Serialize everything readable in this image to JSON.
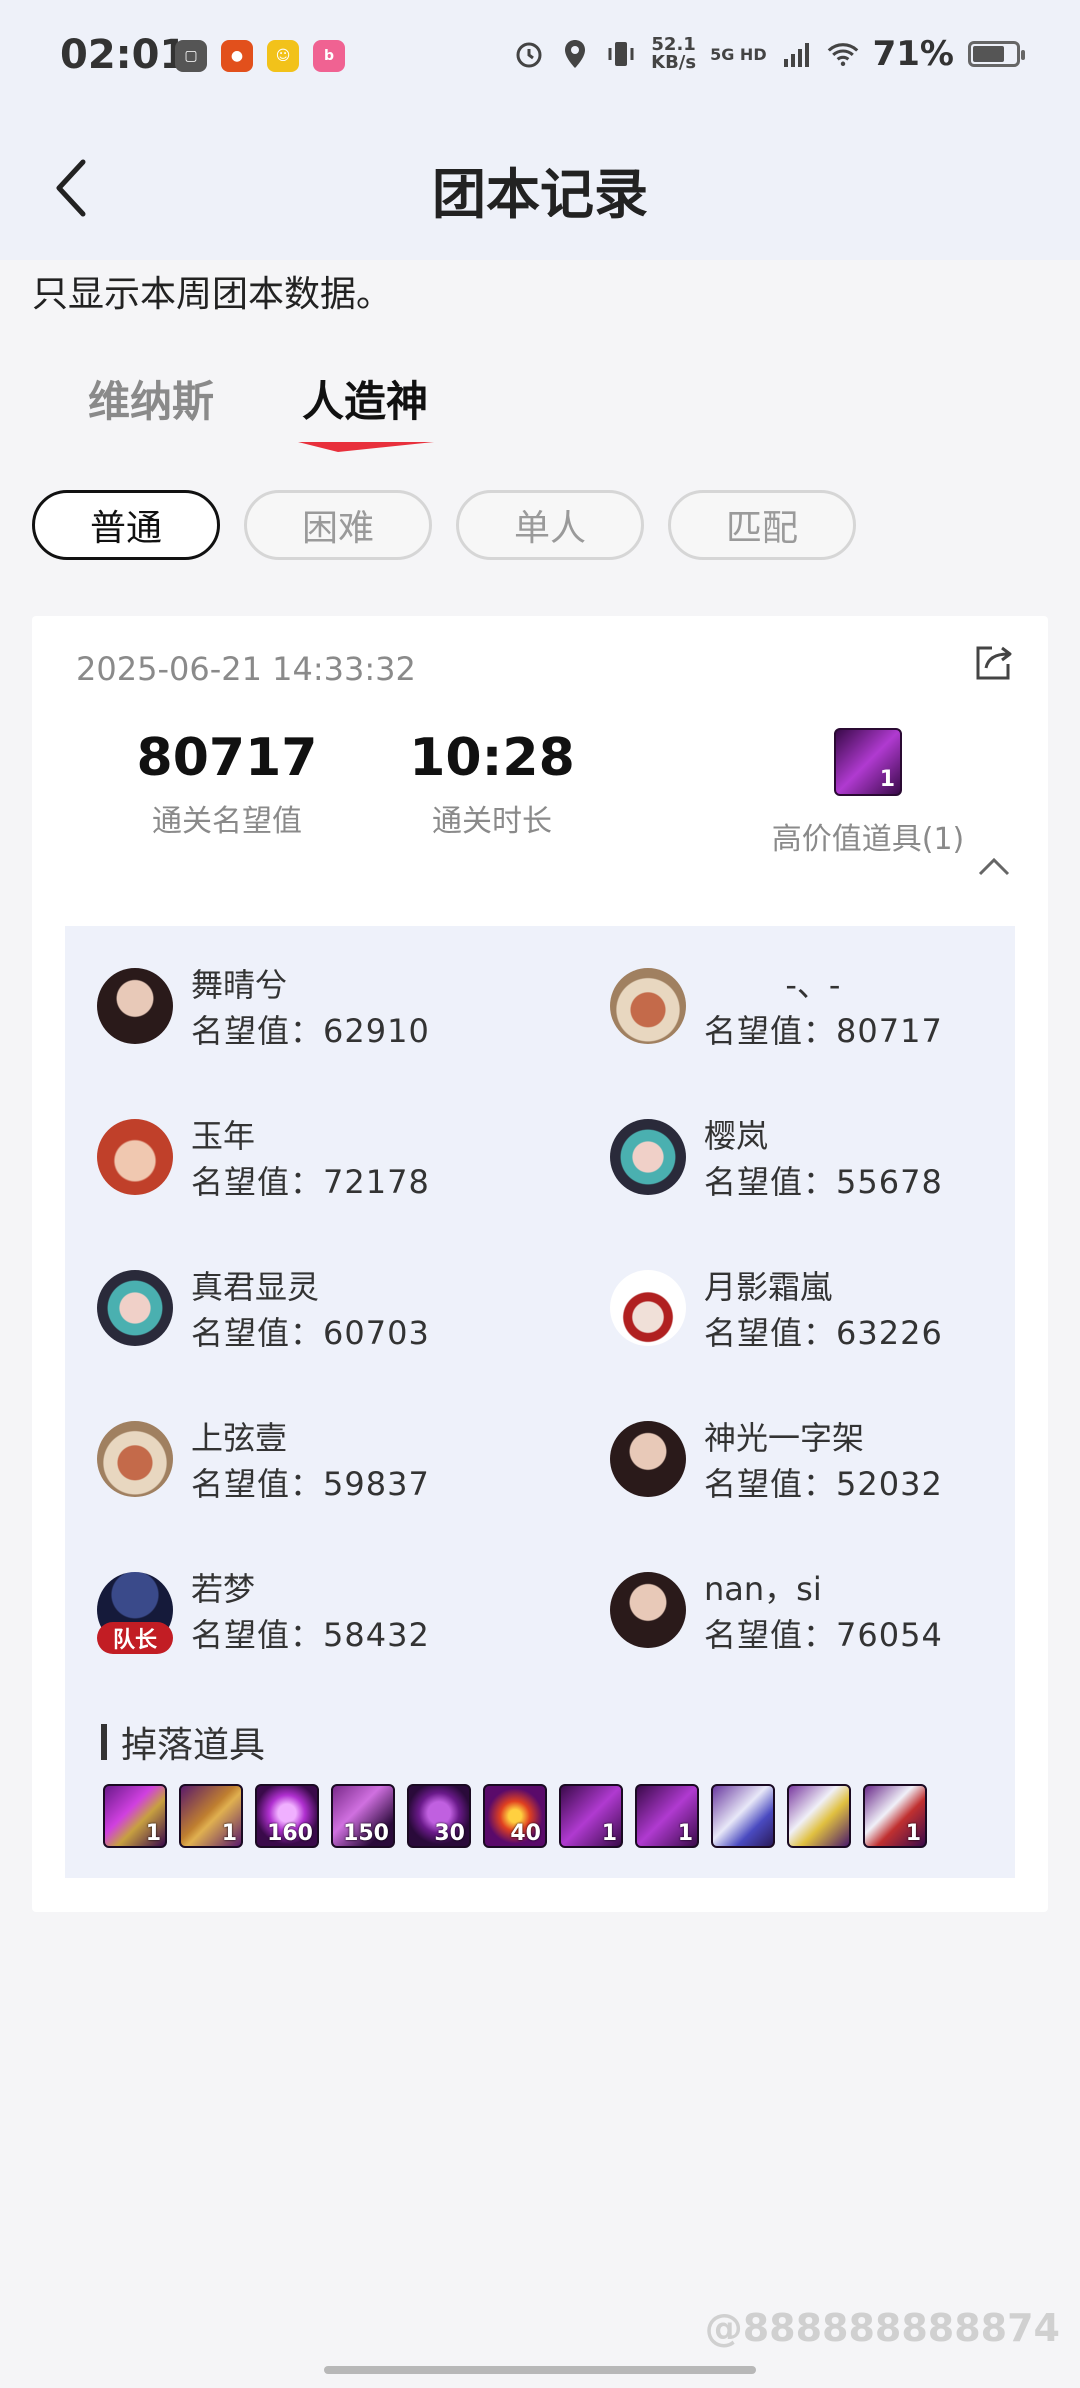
{
  "status": {
    "time": "02:01",
    "net_speed_value": "52.1",
    "net_speed_unit": "KB/s",
    "network": "5G HD",
    "battery": "71%",
    "battery_level": 0.71
  },
  "header": {
    "title": "团本记录"
  },
  "notice": "只显示本周团本数据。",
  "tabs": [
    {
      "label": "维纳斯",
      "active": false
    },
    {
      "label": "人造神",
      "active": true
    }
  ],
  "accent_color": "#e8303c",
  "filters": [
    {
      "label": "普通",
      "selected": true
    },
    {
      "label": "困难",
      "selected": false
    },
    {
      "label": "单人",
      "selected": false
    },
    {
      "label": "匹配",
      "selected": false
    }
  ],
  "record": {
    "datetime": "2025-06-21 14:33:32",
    "reputation": {
      "value": "80717",
      "label": "通关名望值"
    },
    "duration": {
      "value": "10:28",
      "label": "通关时长"
    },
    "high_value": {
      "count": "1",
      "label": "高价值道具(1)"
    },
    "rep_prefix": "名望值：",
    "members": [
      {
        "name": "舞晴兮",
        "rep": "名望值：62910"
      },
      {
        "name": "        -、-",
        "rep": "名望值：80717"
      },
      {
        "name": "玉年",
        "rep": "名望值：72178"
      },
      {
        "name": "樱岚",
        "rep": "名望值：55678"
      },
      {
        "name": "真君显灵",
        "rep": "名望值：60703"
      },
      {
        "name": "月影霜嵐",
        "rep": "名望值：63226"
      },
      {
        "name": "上弦壹",
        "rep": "名望值：59837"
      },
      {
        "name": "神光一字架",
        "rep": "名望值：52032"
      },
      {
        "name": "若梦",
        "rep": "名望值：58432",
        "captain": "队长"
      },
      {
        "name": "nan，si",
        "rep": "名望值：76054"
      }
    ],
    "drops_title": "掉落道具",
    "drops": [
      {
        "count": "1"
      },
      {
        "count": "1"
      },
      {
        "count": "160"
      },
      {
        "count": "150"
      },
      {
        "count": "30"
      },
      {
        "count": "40"
      },
      {
        "count": "1"
      },
      {
        "count": "1"
      },
      {
        "count": ""
      },
      {
        "count": ""
      },
      {
        "count": "1"
      }
    ]
  },
  "watermark": "@888888888874"
}
